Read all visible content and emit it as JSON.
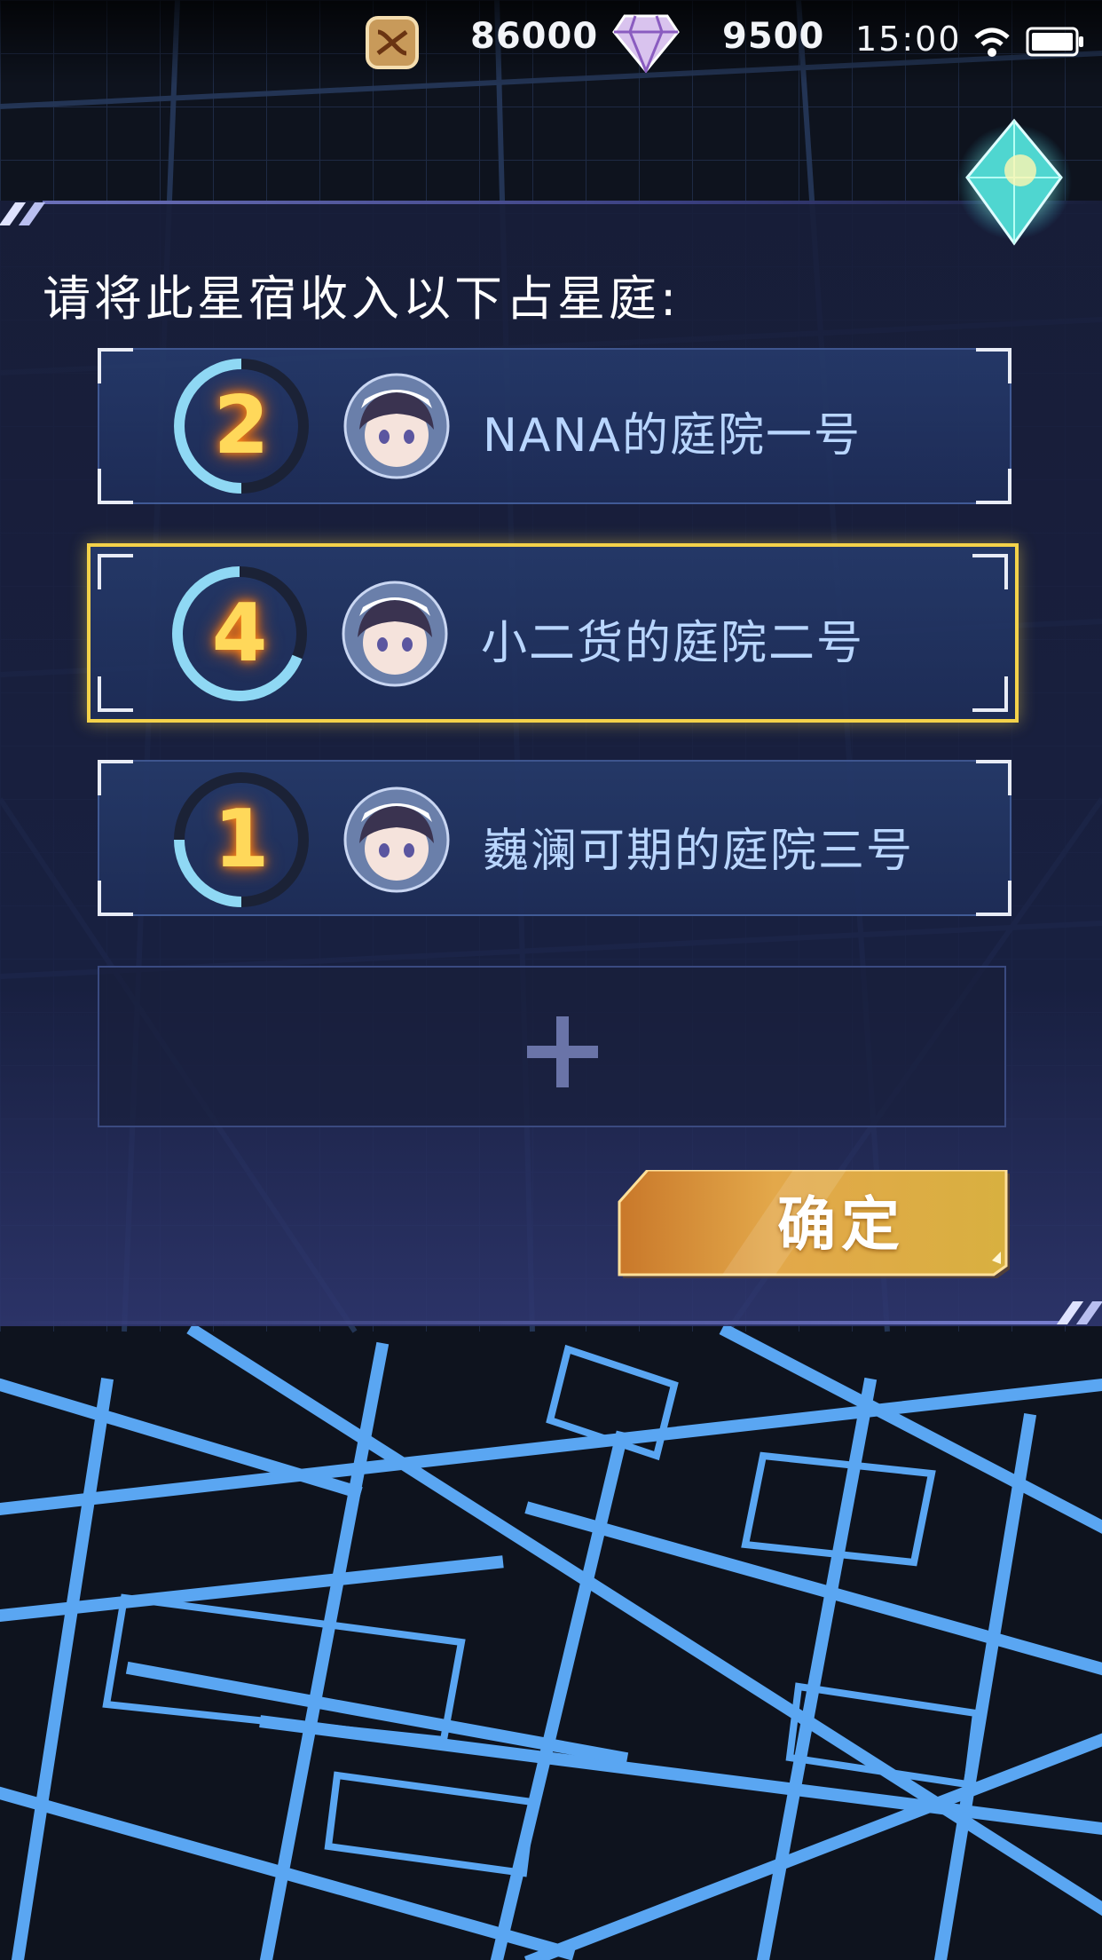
{
  "status_bar": {
    "gold_amount": "86000",
    "gem_amount": "9500",
    "time": "15:00",
    "icons": [
      "coin-icon",
      "diamond-icon",
      "wifi-icon",
      "battery-icon"
    ]
  },
  "dialog": {
    "title": "请将此星宿收入以下占星庭:",
    "gardens": [
      {
        "number": "2",
        "name": "NANA的庭院一号",
        "selected": false,
        "progress": 0.5
      },
      {
        "number": "4",
        "name": "小二货的庭院二号",
        "selected": true,
        "progress": 0.6
      },
      {
        "number": "1",
        "name": "巍澜可期的庭院三号",
        "selected": false,
        "progress": 0.35
      }
    ],
    "add_slot": {
      "icon": "plus-icon"
    },
    "confirm_label": "确定"
  },
  "colors": {
    "selected_border": "#f4d24a",
    "number_glow": "#ffd85a",
    "label_text": "#b9d6ff",
    "confirm_gold": "#e0a640",
    "map_lines": "#5aa6f2"
  }
}
